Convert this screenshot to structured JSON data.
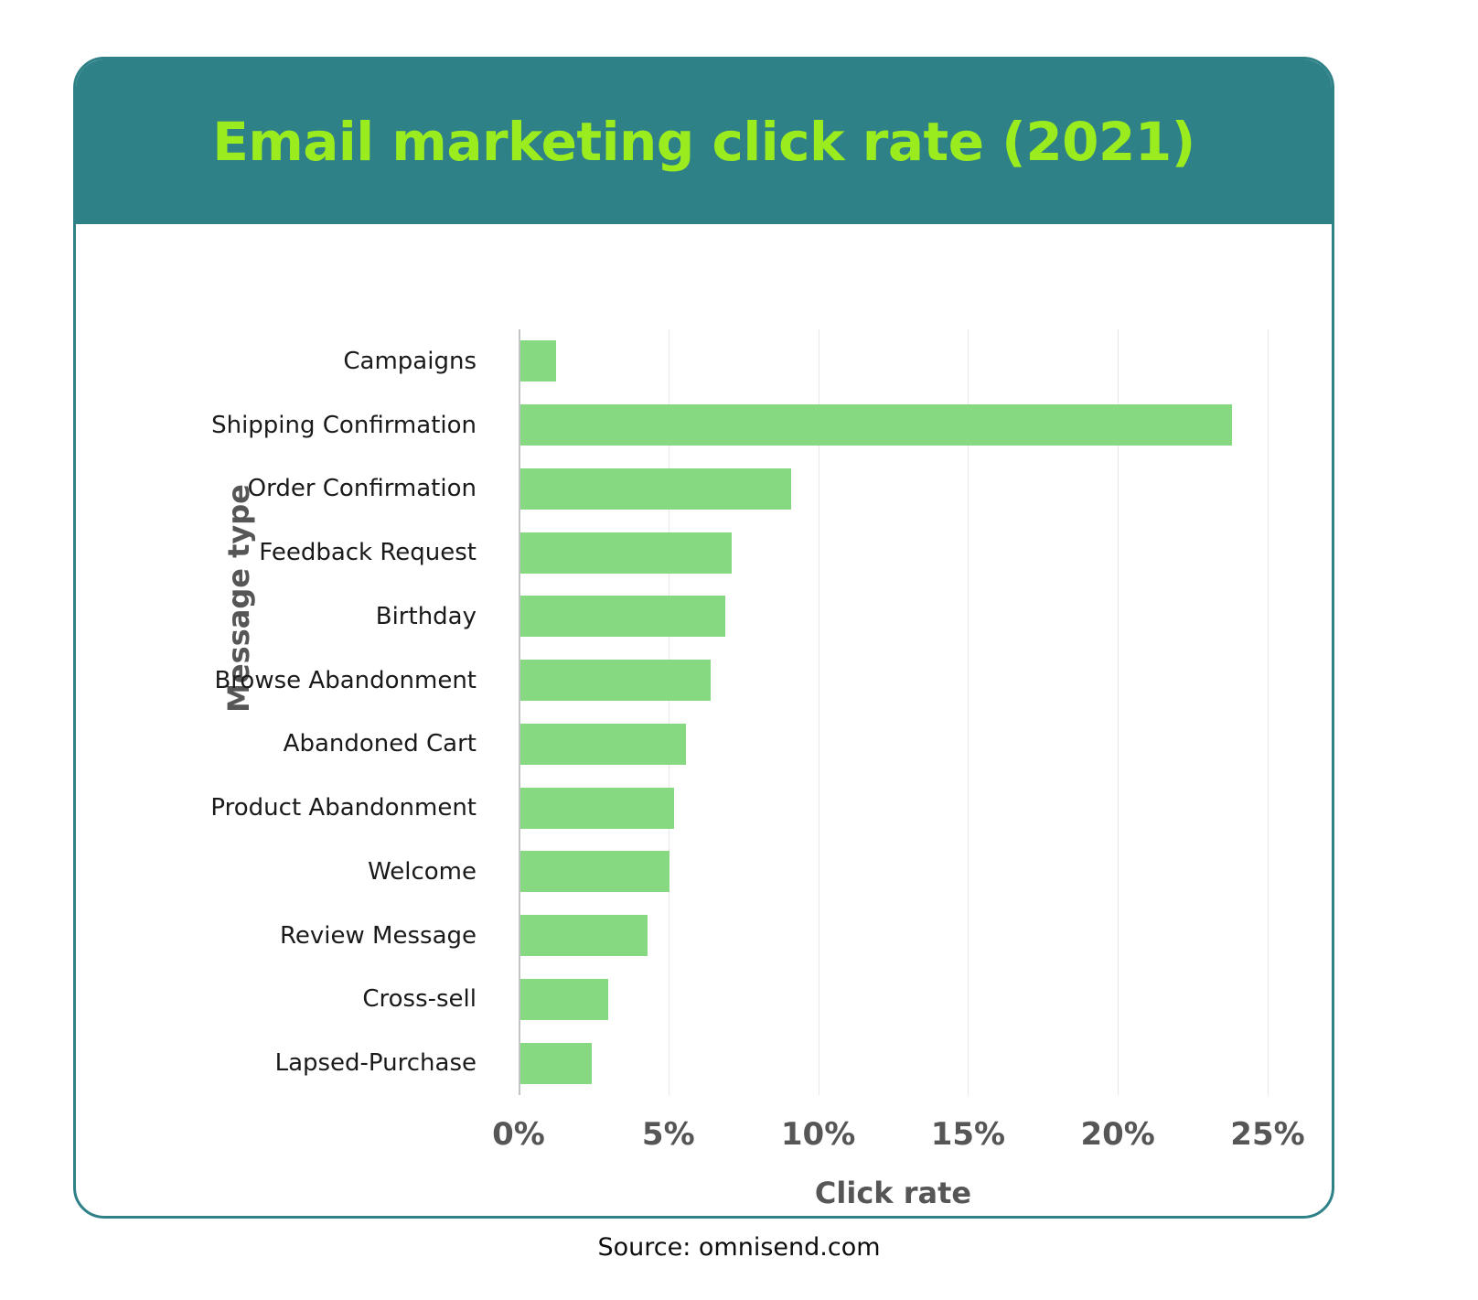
{
  "card": {
    "title": "Email marketing click rate (2021)",
    "header_bg": "#2E8187",
    "title_color": "#9BEC1E",
    "border_color": "#2E8187"
  },
  "source_note": "Source: omnisend.com",
  "chart_data": {
    "type": "bar",
    "orientation": "horizontal",
    "title": "Email marketing click rate (2021)",
    "subtitle": "",
    "xlabel": "Click rate",
    "ylabel": "Message type",
    "categories": [
      "Campaigns",
      "Shipping Confirmation",
      "Order Confirmation",
      "Feedback Request",
      "Birthday",
      "Browse Abandonment",
      "Abandoned Cart",
      "Product Abandonment",
      "Welcome",
      "Review Message",
      "Cross-sell",
      "Lapsed-Purchase"
    ],
    "values": [
      1.25,
      23.8,
      9.1,
      7.1,
      6.9,
      6.4,
      5.6,
      5.2,
      5.05,
      4.3,
      3.0,
      2.45
    ],
    "value_unit": "%",
    "xlim": [
      0,
      25
    ],
    "xticks": [
      0,
      5,
      10,
      15,
      20,
      25
    ],
    "xtick_labels": [
      "0%",
      "5%",
      "10%",
      "15%",
      "20%",
      "25%"
    ],
    "grid": "vertical",
    "legend": "none",
    "bar_color": "#86D980",
    "axis_color": "#BFC4C4",
    "gridline_color": "#E8E8E8",
    "tick_label_color": "#565656"
  }
}
